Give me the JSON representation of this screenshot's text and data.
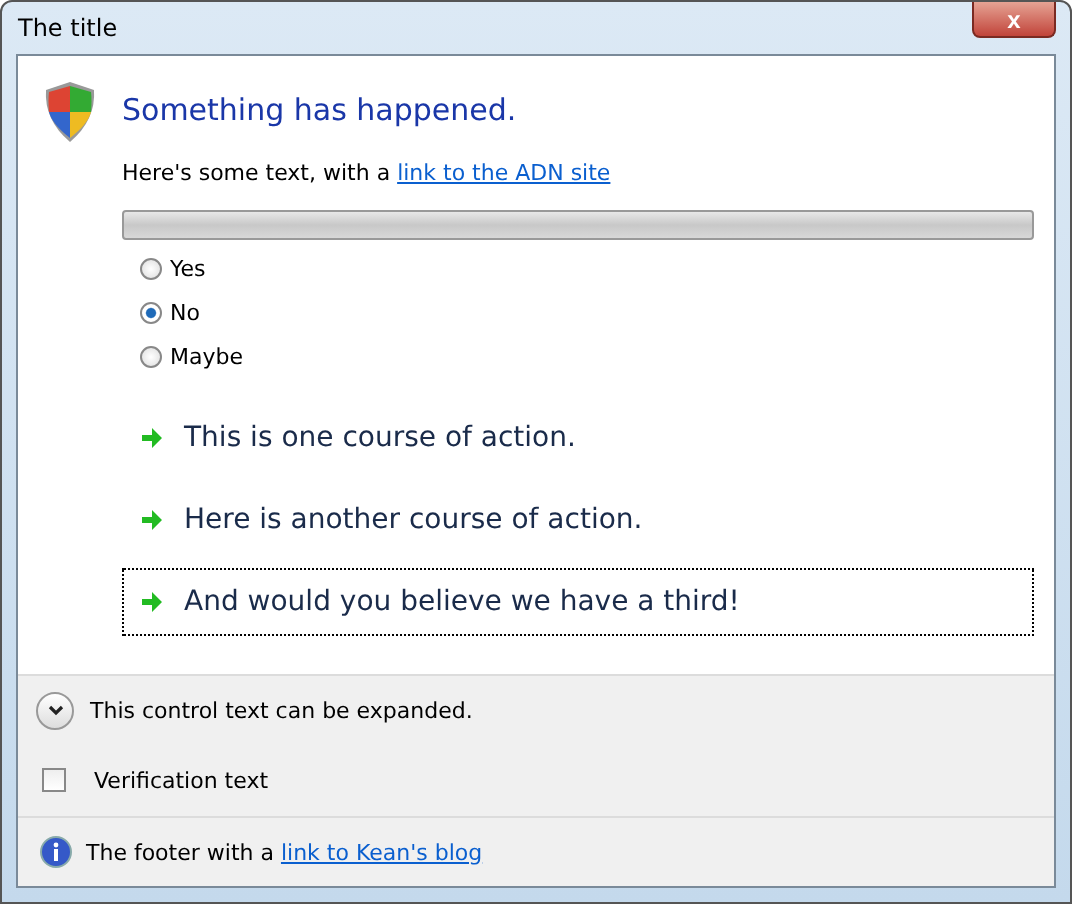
{
  "window": {
    "title": "The title",
    "close_label": "x"
  },
  "main_instruction": "Something has happened.",
  "content": {
    "text": "Here's some text, with a ",
    "link": "link to the ADN site"
  },
  "progress": {
    "level": 0
  },
  "radios": [
    {
      "label": "Yes",
      "selected": false
    },
    {
      "label": "No",
      "selected": true
    },
    {
      "label": "Maybe",
      "selected": false
    }
  ],
  "command_links": [
    {
      "label": "This is one course of action.",
      "focused": false
    },
    {
      "label": "Here is another course of action.",
      "focused": false
    },
    {
      "label": "And would you believe we have a third!",
      "focused": true
    }
  ],
  "expander": {
    "label": "This control text can be expanded.",
    "expanded": false
  },
  "verification": {
    "label": "Verification text",
    "checked": false
  },
  "footer": {
    "text": "The footer with a ",
    "link": "link to Kean's blog"
  }
}
